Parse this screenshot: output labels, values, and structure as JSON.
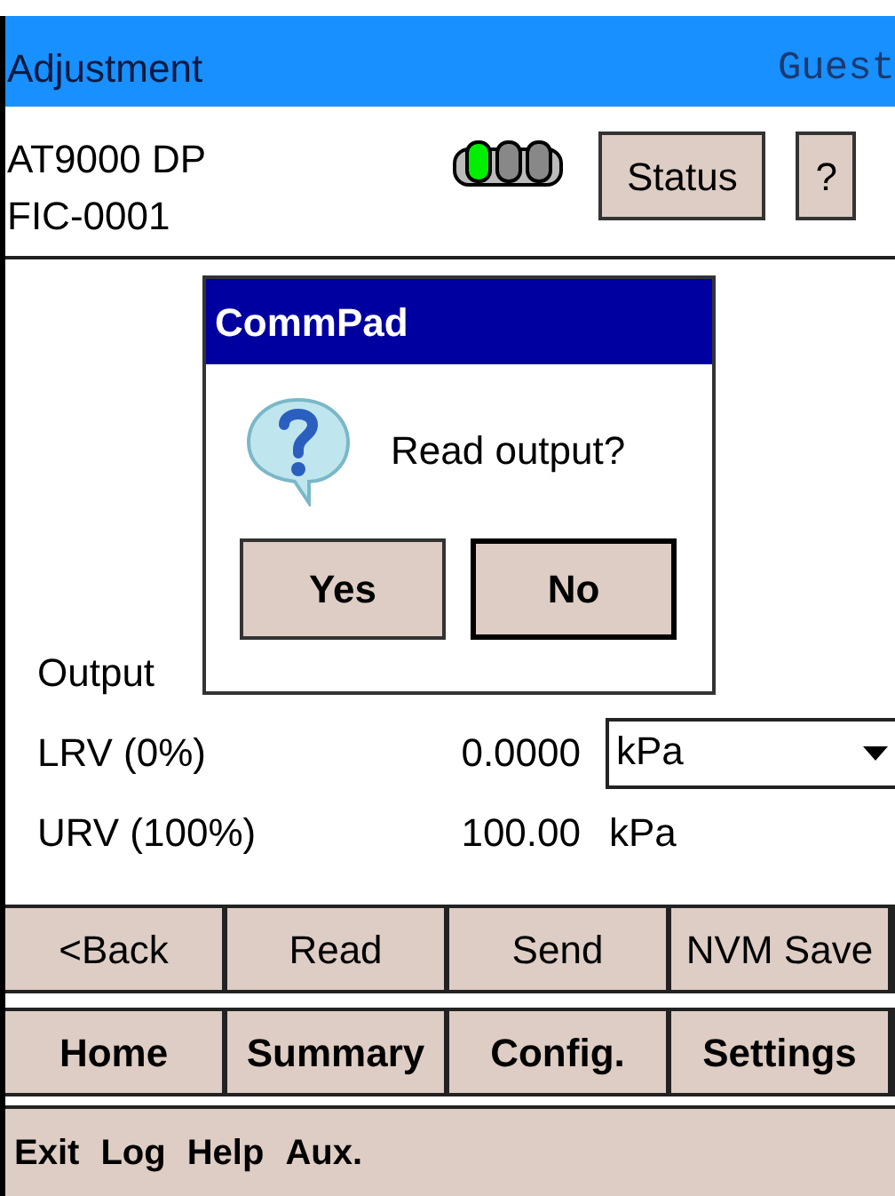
{
  "title_bar": {
    "title": "Adjustment",
    "user": "Guest"
  },
  "header": {
    "device": "AT9000 DP",
    "tag": "FIC-0001",
    "status_button": "Status",
    "help_button": "?"
  },
  "fields": [
    {
      "kind": "label",
      "label": "Output"
    },
    {
      "kind": "select",
      "label": "LRV (0%)",
      "value": "0.0000",
      "unit": "kPa"
    },
    {
      "kind": "text",
      "label": "URV (100%)",
      "value": "100.00",
      "unit": "kPa"
    }
  ],
  "action_buttons": [
    "<Back",
    "Read",
    "Send",
    "NVM Save"
  ],
  "nav_buttons": [
    "Home",
    "Summary",
    "Config.",
    "Settings"
  ],
  "menu": [
    "Exit",
    "Log",
    "Help",
    "Aux."
  ],
  "dialog": {
    "title": "CommPad",
    "message": "Read output?",
    "buttons": [
      {
        "label": "Yes",
        "default": false
      },
      {
        "label": "No",
        "default": true
      }
    ]
  }
}
